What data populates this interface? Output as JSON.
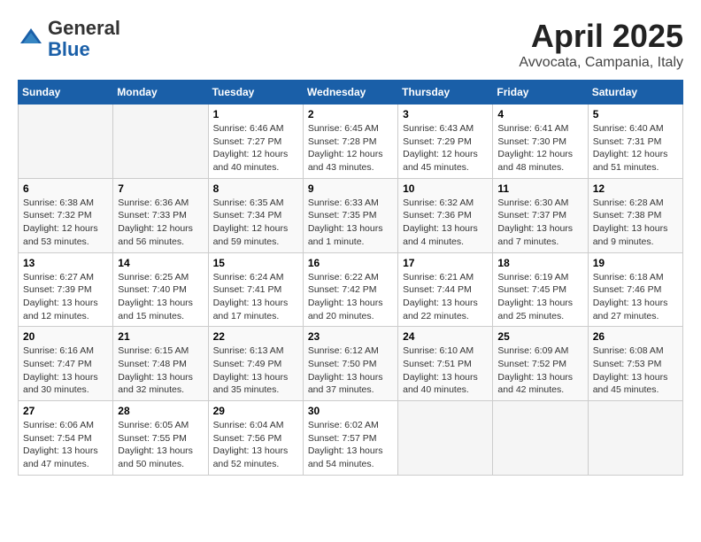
{
  "logo": {
    "general": "General",
    "blue": "Blue"
  },
  "title": "April 2025",
  "subtitle": "Avvocata, Campania, Italy",
  "days_of_week": [
    "Sunday",
    "Monday",
    "Tuesday",
    "Wednesday",
    "Thursday",
    "Friday",
    "Saturday"
  ],
  "weeks": [
    [
      {
        "day": "",
        "sunrise": "",
        "sunset": "",
        "daylight": ""
      },
      {
        "day": "",
        "sunrise": "",
        "sunset": "",
        "daylight": ""
      },
      {
        "day": "1",
        "sunrise": "Sunrise: 6:46 AM",
        "sunset": "Sunset: 7:27 PM",
        "daylight": "Daylight: 12 hours and 40 minutes."
      },
      {
        "day": "2",
        "sunrise": "Sunrise: 6:45 AM",
        "sunset": "Sunset: 7:28 PM",
        "daylight": "Daylight: 12 hours and 43 minutes."
      },
      {
        "day": "3",
        "sunrise": "Sunrise: 6:43 AM",
        "sunset": "Sunset: 7:29 PM",
        "daylight": "Daylight: 12 hours and 45 minutes."
      },
      {
        "day": "4",
        "sunrise": "Sunrise: 6:41 AM",
        "sunset": "Sunset: 7:30 PM",
        "daylight": "Daylight: 12 hours and 48 minutes."
      },
      {
        "day": "5",
        "sunrise": "Sunrise: 6:40 AM",
        "sunset": "Sunset: 7:31 PM",
        "daylight": "Daylight: 12 hours and 51 minutes."
      }
    ],
    [
      {
        "day": "6",
        "sunrise": "Sunrise: 6:38 AM",
        "sunset": "Sunset: 7:32 PM",
        "daylight": "Daylight: 12 hours and 53 minutes."
      },
      {
        "day": "7",
        "sunrise": "Sunrise: 6:36 AM",
        "sunset": "Sunset: 7:33 PM",
        "daylight": "Daylight: 12 hours and 56 minutes."
      },
      {
        "day": "8",
        "sunrise": "Sunrise: 6:35 AM",
        "sunset": "Sunset: 7:34 PM",
        "daylight": "Daylight: 12 hours and 59 minutes."
      },
      {
        "day": "9",
        "sunrise": "Sunrise: 6:33 AM",
        "sunset": "Sunset: 7:35 PM",
        "daylight": "Daylight: 13 hours and 1 minute."
      },
      {
        "day": "10",
        "sunrise": "Sunrise: 6:32 AM",
        "sunset": "Sunset: 7:36 PM",
        "daylight": "Daylight: 13 hours and 4 minutes."
      },
      {
        "day": "11",
        "sunrise": "Sunrise: 6:30 AM",
        "sunset": "Sunset: 7:37 PM",
        "daylight": "Daylight: 13 hours and 7 minutes."
      },
      {
        "day": "12",
        "sunrise": "Sunrise: 6:28 AM",
        "sunset": "Sunset: 7:38 PM",
        "daylight": "Daylight: 13 hours and 9 minutes."
      }
    ],
    [
      {
        "day": "13",
        "sunrise": "Sunrise: 6:27 AM",
        "sunset": "Sunset: 7:39 PM",
        "daylight": "Daylight: 13 hours and 12 minutes."
      },
      {
        "day": "14",
        "sunrise": "Sunrise: 6:25 AM",
        "sunset": "Sunset: 7:40 PM",
        "daylight": "Daylight: 13 hours and 15 minutes."
      },
      {
        "day": "15",
        "sunrise": "Sunrise: 6:24 AM",
        "sunset": "Sunset: 7:41 PM",
        "daylight": "Daylight: 13 hours and 17 minutes."
      },
      {
        "day": "16",
        "sunrise": "Sunrise: 6:22 AM",
        "sunset": "Sunset: 7:42 PM",
        "daylight": "Daylight: 13 hours and 20 minutes."
      },
      {
        "day": "17",
        "sunrise": "Sunrise: 6:21 AM",
        "sunset": "Sunset: 7:44 PM",
        "daylight": "Daylight: 13 hours and 22 minutes."
      },
      {
        "day": "18",
        "sunrise": "Sunrise: 6:19 AM",
        "sunset": "Sunset: 7:45 PM",
        "daylight": "Daylight: 13 hours and 25 minutes."
      },
      {
        "day": "19",
        "sunrise": "Sunrise: 6:18 AM",
        "sunset": "Sunset: 7:46 PM",
        "daylight": "Daylight: 13 hours and 27 minutes."
      }
    ],
    [
      {
        "day": "20",
        "sunrise": "Sunrise: 6:16 AM",
        "sunset": "Sunset: 7:47 PM",
        "daylight": "Daylight: 13 hours and 30 minutes."
      },
      {
        "day": "21",
        "sunrise": "Sunrise: 6:15 AM",
        "sunset": "Sunset: 7:48 PM",
        "daylight": "Daylight: 13 hours and 32 minutes."
      },
      {
        "day": "22",
        "sunrise": "Sunrise: 6:13 AM",
        "sunset": "Sunset: 7:49 PM",
        "daylight": "Daylight: 13 hours and 35 minutes."
      },
      {
        "day": "23",
        "sunrise": "Sunrise: 6:12 AM",
        "sunset": "Sunset: 7:50 PM",
        "daylight": "Daylight: 13 hours and 37 minutes."
      },
      {
        "day": "24",
        "sunrise": "Sunrise: 6:10 AM",
        "sunset": "Sunset: 7:51 PM",
        "daylight": "Daylight: 13 hours and 40 minutes."
      },
      {
        "day": "25",
        "sunrise": "Sunrise: 6:09 AM",
        "sunset": "Sunset: 7:52 PM",
        "daylight": "Daylight: 13 hours and 42 minutes."
      },
      {
        "day": "26",
        "sunrise": "Sunrise: 6:08 AM",
        "sunset": "Sunset: 7:53 PM",
        "daylight": "Daylight: 13 hours and 45 minutes."
      }
    ],
    [
      {
        "day": "27",
        "sunrise": "Sunrise: 6:06 AM",
        "sunset": "Sunset: 7:54 PM",
        "daylight": "Daylight: 13 hours and 47 minutes."
      },
      {
        "day": "28",
        "sunrise": "Sunrise: 6:05 AM",
        "sunset": "Sunset: 7:55 PM",
        "daylight": "Daylight: 13 hours and 50 minutes."
      },
      {
        "day": "29",
        "sunrise": "Sunrise: 6:04 AM",
        "sunset": "Sunset: 7:56 PM",
        "daylight": "Daylight: 13 hours and 52 minutes."
      },
      {
        "day": "30",
        "sunrise": "Sunrise: 6:02 AM",
        "sunset": "Sunset: 7:57 PM",
        "daylight": "Daylight: 13 hours and 54 minutes."
      },
      {
        "day": "",
        "sunrise": "",
        "sunset": "",
        "daylight": ""
      },
      {
        "day": "",
        "sunrise": "",
        "sunset": "",
        "daylight": ""
      },
      {
        "day": "",
        "sunrise": "",
        "sunset": "",
        "daylight": ""
      }
    ]
  ]
}
